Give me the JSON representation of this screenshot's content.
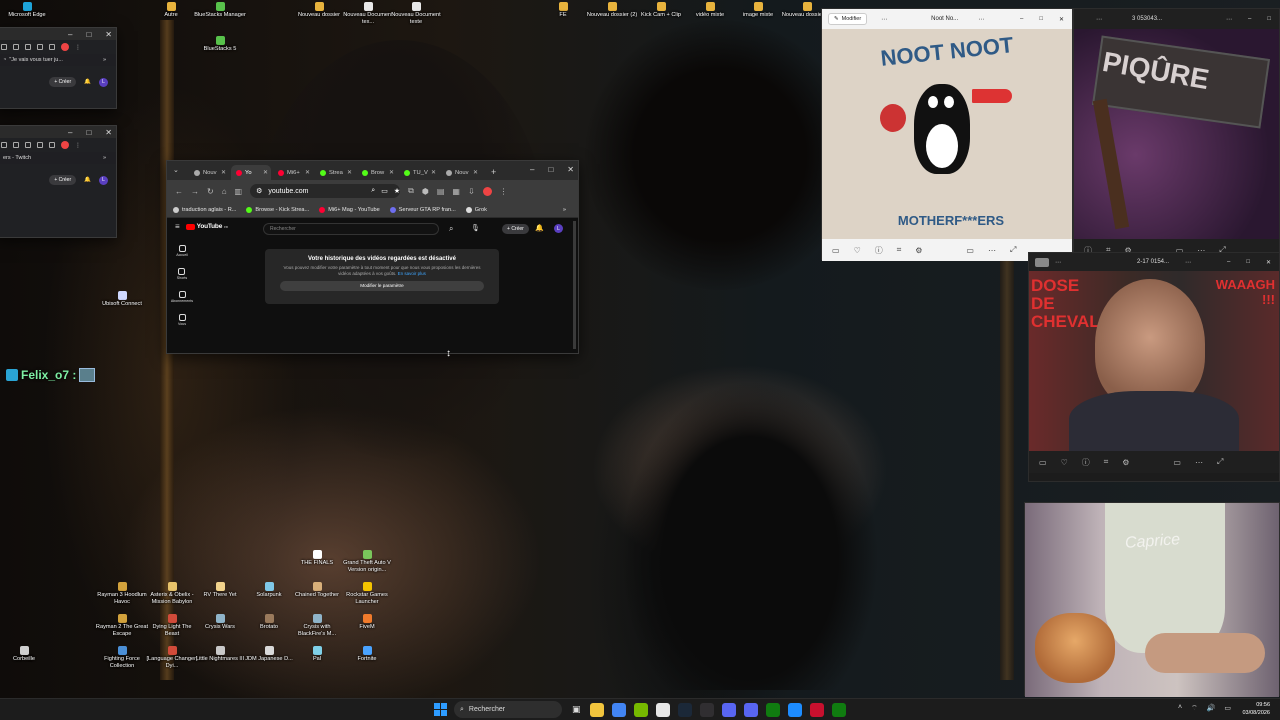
{
  "desktop": {
    "top_icons": [
      {
        "label": "Microsoft Edge",
        "color": "#1ea4d9"
      },
      {
        "label": "Autre",
        "color": "#e8b33d"
      },
      {
        "label": "BlueStacks Manager",
        "color": "#58c24b"
      },
      {
        "label": "BlueStacks 5",
        "color": "#58c24b"
      },
      {
        "label": "Nouveau dossier",
        "color": "#e8b33d"
      },
      {
        "label": "Nouveau Document tex...",
        "color": "#e9e9e9"
      },
      {
        "label": "Nouveau Document texte",
        "color": "#e9e9e9"
      },
      {
        "label": "FE",
        "color": "#e8b33d"
      },
      {
        "label": "Nouveau dossier (2)",
        "color": "#e8b33d"
      },
      {
        "label": "Kick Cam + Clip",
        "color": "#e8b33d"
      },
      {
        "label": "vidéo mixte",
        "color": "#e8b33d"
      },
      {
        "label": "image mixte",
        "color": "#e8b33d"
      },
      {
        "label": "Nouveau dossier (3)",
        "color": "#e8b33d"
      },
      {
        "label": "Ubisoft Connect",
        "color": "#cfd8ff"
      },
      {
        "label": "Corbeille",
        "color": "#cfcfcf"
      }
    ],
    "game_icons": [
      {
        "label": "THE FINALS",
        "color": "#ffffff"
      },
      {
        "label": "Grand Theft Auto V Version origin...",
        "color": "#7ac65b"
      },
      {
        "label": "Rayman 3 Hoodlum Havoc",
        "color": "#d2a23c"
      },
      {
        "label": "Asterix & Obelix - Mission Babylon",
        "color": "#e8c36a"
      },
      {
        "label": "RV There Yet",
        "color": "#f2d38c"
      },
      {
        "label": "Solarpunk",
        "color": "#7fc8e8"
      },
      {
        "label": "Chained Together",
        "color": "#d9b07a"
      },
      {
        "label": "Rockstar Games Launcher",
        "color": "#f5c400"
      },
      {
        "label": "Rayman 2 The Great Escape",
        "color": "#d2a23c"
      },
      {
        "label": "Dying Light The Beast",
        "color": "#d14b3a"
      },
      {
        "label": "Crysis Wars",
        "color": "#8fb4c9"
      },
      {
        "label": "Brotato",
        "color": "#9a7a5c"
      },
      {
        "label": "Crysis with BlackFire's M...",
        "color": "#8fb4c9"
      },
      {
        "label": "FiveM",
        "color": "#f17b2c"
      },
      {
        "label": "Fighting Force Collection",
        "color": "#4b8fd6"
      },
      {
        "label": "[Language Changer] Dyi...",
        "color": "#d14b3a"
      },
      {
        "label": "Little Nightmares III",
        "color": "#c9c9c9"
      },
      {
        "label": "JDM Japanese D...",
        "color": "#d9d9d9"
      },
      {
        "label": "Pal",
        "color": "#7fd0e8"
      },
      {
        "label": "Fortnite",
        "color": "#4aa3ff"
      }
    ],
    "overlay_name": "Felix_o7 :"
  },
  "twitch_windows": [
    {
      "chat_line": "\"Je vais vous tuer ju...",
      "create_label": "Créer",
      "avatar_letter": "L"
    },
    {
      "tab_label": "ers - Twitch",
      "create_label": "Créer",
      "avatar_letter": "L"
    }
  ],
  "chrome": {
    "tabs": [
      {
        "label": "Nouv",
        "color": "#aaaaaa"
      },
      {
        "label": "Yo",
        "color": "#ff0033",
        "active": true
      },
      {
        "label": "Mi6+",
        "color": "#ff0033"
      },
      {
        "label": "Strea",
        "color": "#53fc18"
      },
      {
        "label": "Brow",
        "color": "#53fc18"
      },
      {
        "label": "TU_V",
        "color": "#53fc18"
      },
      {
        "label": "Nouv",
        "color": "#aaaaaa"
      }
    ],
    "url": "youtube.com",
    "bookmarks": [
      {
        "label": "traduction aglais - R...",
        "color": "#cccccc"
      },
      {
        "label": "Browse - Kick Strea...",
        "color": "#53fc18"
      },
      {
        "label": "Mi6+ Mag - YouTube",
        "color": "#ff0033"
      },
      {
        "label": "Serveur GTA RP fran...",
        "color": "#6e6ef0"
      },
      {
        "label": "Grok",
        "color": "#dddddd"
      }
    ],
    "youtube": {
      "logo": "YouTube",
      "logo_suffix": "FR",
      "search_placeholder": "Rechercher",
      "create_label": "Créer",
      "avatar_letter": "L",
      "nav": [
        "Accueil",
        "Shorts",
        "Abonnements",
        "Vous"
      ],
      "card_title": "Votre historique des vidéos regardées est désactivé",
      "card_text": "Vous pouvez modifier votre paramètre à tout moment pour que nous vous proposions les dernières vidéos adaptées à vos goûts.",
      "card_link": "En savoir plus",
      "card_button": "Modifier le paramètre"
    }
  },
  "photo_windows": [
    {
      "edit_label": "Modifier",
      "title": "Noot No...",
      "image_text_top": "NOOT NOOT",
      "image_text_bottom": "MOTHERF***ERS"
    },
    {
      "title": "3 053043...",
      "image_text": "PIQÛRE"
    },
    {
      "title": "2-17 0154...",
      "image_text": "DOSE DE CHEVAL",
      "side_text": "WAAAGH !!!"
    },
    {
      "title": "",
      "image_text": "Caprice"
    }
  ],
  "taskbar": {
    "search_label": "Rechercher",
    "time": "09:56",
    "date": "03/08/2026",
    "apps": [
      {
        "name": "file-explorer",
        "color": "#f2c53d"
      },
      {
        "name": "chrome",
        "color": "#4285f4"
      },
      {
        "name": "nvidia",
        "color": "#76b900"
      },
      {
        "name": "notepad",
        "color": "#e6e6e6"
      },
      {
        "name": "steam",
        "color": "#1b2838"
      },
      {
        "name": "obs",
        "color": "#302e31"
      },
      {
        "name": "discord",
        "color": "#5865f2"
      },
      {
        "name": "discord-ptb",
        "color": "#5865f2"
      },
      {
        "name": "xbox",
        "color": "#107c10"
      },
      {
        "name": "snipping",
        "color": "#1d8cff"
      },
      {
        "name": "game",
        "color": "#c8102e"
      },
      {
        "name": "xbox-app",
        "color": "#107c10"
      }
    ]
  }
}
